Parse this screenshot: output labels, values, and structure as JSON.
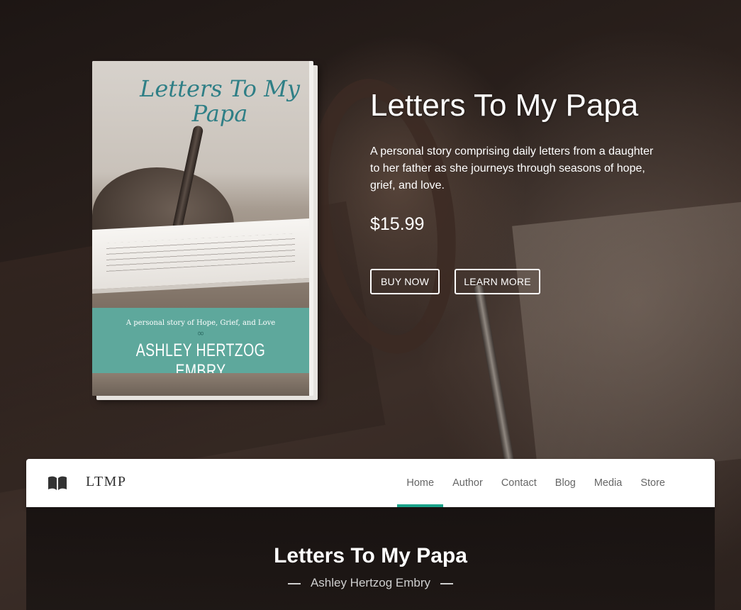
{
  "book": {
    "title": "Letters To My Papa",
    "tagline": "A personal story of Hope, Grief, and Love",
    "symbol": "∞",
    "author": "ASHLEY HERTZOG EMBRY"
  },
  "hero": {
    "title": "Letters To My Papa",
    "description": "A personal story comprising daily letters from a daughter to her father as she journeys through seasons of hope, grief, and love.",
    "price": "$15.99",
    "buy_label": "BUY NOW",
    "learn_label": "LEARN MORE"
  },
  "navbar": {
    "brand": "LTMP",
    "brand_icon": "open-book-icon",
    "items": [
      {
        "label": "Home",
        "active": true
      },
      {
        "label": "Author",
        "active": false
      },
      {
        "label": "Contact",
        "active": false
      },
      {
        "label": "Blog",
        "active": false
      },
      {
        "label": "Media",
        "active": false
      },
      {
        "label": "Store",
        "active": false
      }
    ],
    "accent_color": "#1aa38a"
  },
  "section": {
    "title": "Letters To My Papa",
    "subtitle": "Ashley Hertzog Embry"
  }
}
